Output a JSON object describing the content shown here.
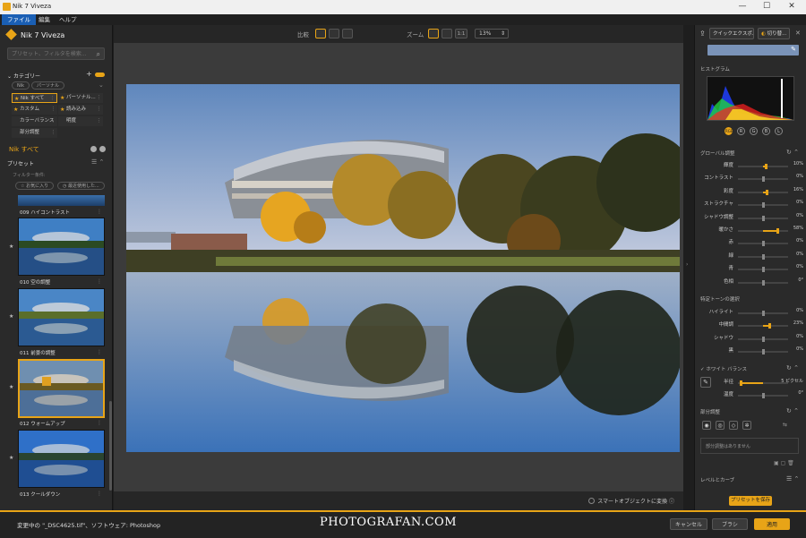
{
  "window": {
    "title": "Nik 7 Viveza",
    "minimize": "—",
    "maximize": "☐",
    "close": "✕"
  },
  "menu": {
    "items": [
      "ファイル",
      "編集",
      "ヘルプ"
    ]
  },
  "left": {
    "app_name": "Nik 7 Viveza",
    "search_placeholder": "プリセット、フィルタを検索...",
    "category_header": "カテゴリー",
    "filter_chips": [
      "Nik",
      "パーソナル"
    ],
    "categories": [
      "Nik すべて",
      "パーソナル...",
      "カスタム",
      "読み込み",
      "カラーバランス",
      "明度",
      "部分調整"
    ],
    "nik_all": "Nik すべて",
    "preset_header": "プリセット",
    "filter_cond": "フィルター条件:",
    "fav_chip": "☆ お気に入り",
    "recent_chip": "◷ 最近使用した...",
    "presets": [
      "009 ハイコントラスト",
      "010 空の調整",
      "011 前景の調整",
      "012 ウォームアップ",
      "013 クールダウン"
    ]
  },
  "center": {
    "compare_label": "比較",
    "zoom_label": "ズーム",
    "zoom_1to1": "1:1",
    "zoom_value": "13%",
    "convert_label": "スマートオブジェクトに変換"
  },
  "right": {
    "quick_export": "クイックエクスポ...",
    "crop": "切り替...",
    "histogram": "ヒストグラム",
    "channels": [
      "RGB",
      "R",
      "G",
      "B",
      "L"
    ],
    "global_header": "グローバル調整",
    "global": [
      {
        "label": "輝度",
        "value": "10%",
        "pos": 0.55
      },
      {
        "label": "コントラスト",
        "value": "0%",
        "pos": 0.5
      },
      {
        "label": "彩度",
        "value": "16%",
        "pos": 0.58
      },
      {
        "label": "ストラクチャ",
        "value": "0%",
        "pos": 0.5
      },
      {
        "label": "シャドウ調整",
        "value": "0%",
        "pos": 0.5
      },
      {
        "label": "暖かさ",
        "value": "58%",
        "pos": 0.79
      },
      {
        "label": "赤",
        "value": "0%",
        "pos": 0.5
      },
      {
        "label": "緑",
        "value": "0%",
        "pos": 0.5
      },
      {
        "label": "青",
        "value": "0%",
        "pos": 0.5
      },
      {
        "label": "色相",
        "value": "0°",
        "pos": 0.5
      }
    ],
    "tone_header": "特定トーンの選択",
    "tone": [
      {
        "label": "ハイライト",
        "value": "0%",
        "pos": 0.5
      },
      {
        "label": "中間調",
        "value": "23%",
        "pos": 0.62
      },
      {
        "label": "シャドウ",
        "value": "0%",
        "pos": 0.5
      },
      {
        "label": "黒",
        "value": "0%",
        "pos": 0.5
      }
    ],
    "wb_header": "ホワイト バランス",
    "wb": [
      {
        "label": "半径",
        "value": "5 ピクセル",
        "pos": 0.05
      },
      {
        "label": "温度",
        "value": "0°",
        "pos": 0.5
      }
    ],
    "partial_header": "部分調整",
    "partial_none": "部分調整はありません",
    "levels_header": "レベルとカーブ",
    "save_preset": "プリセットを保存"
  },
  "status": {
    "message": "変更中の \"_DSC4625.tif\"、ソフトウェア: Photoshop",
    "watermark": "PHOTOGRAFAN.COM",
    "cancel": "キャンセル",
    "brush": "ブラシ",
    "apply": "適用"
  },
  "colors": {
    "accent": "#e8a417",
    "panel": "#2a2a2a",
    "canvas": "#3b3b3b",
    "menu_active": "#1a5fb4"
  }
}
